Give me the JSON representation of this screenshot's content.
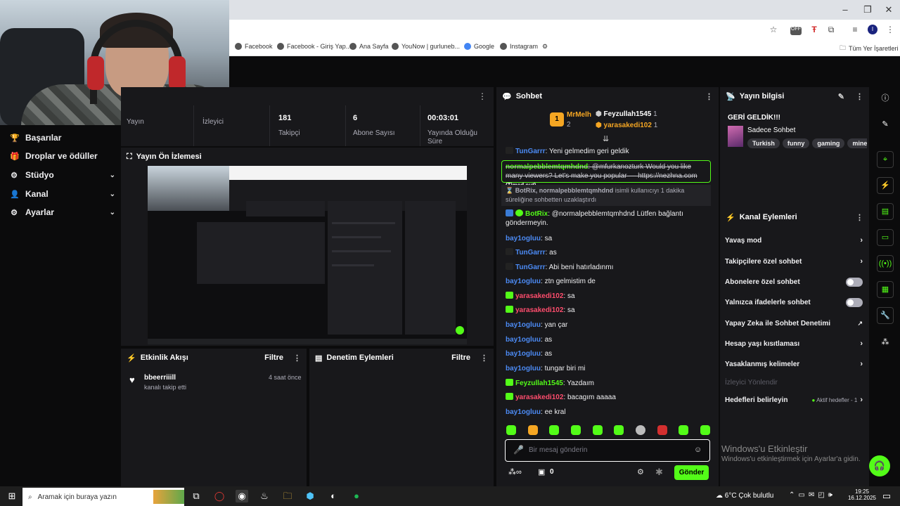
{
  "browser": {
    "bookmarks": [
      "Facebook",
      "Facebook - Giriş Yap...",
      "Ana Sayfa",
      "YouNow | gurluneb...",
      "Google",
      "Instagram"
    ],
    "all_bookmarks": "Tüm Yer İşaretleri",
    "ext_off": "OFF",
    "profile_initial": "I"
  },
  "sidebar": {
    "items": [
      {
        "label": "Başarılar",
        "icon": "trophy-icon"
      },
      {
        "label": "Droplar ve ödüller",
        "icon": "gift-icon"
      },
      {
        "label": "Stüdyo",
        "icon": "gear-icon"
      },
      {
        "label": "Kanal",
        "icon": "user-icon"
      },
      {
        "label": "Ayarlar",
        "icon": "gear-icon"
      }
    ]
  },
  "stats": {
    "items": [
      {
        "value": "",
        "label": "Yayın"
      },
      {
        "value": "",
        "label": "İzleyici"
      },
      {
        "value": "181",
        "label": "Takipçi"
      },
      {
        "value": "6",
        "label": "Abone Sayısı"
      },
      {
        "value": "00:03:01",
        "label": "Yayında Olduğu Süre"
      }
    ]
  },
  "preview": {
    "title": "Yayın Ön İzlemesi"
  },
  "activity": {
    "title": "Etkinlik Akışı",
    "filter": "Filtre",
    "events": [
      {
        "user": "bbeerriiill",
        "text": "kanalı takip etti",
        "time": "4 saat önce"
      }
    ]
  },
  "moderation": {
    "title": "Denetim Eylemleri",
    "filter": "Filtre"
  },
  "chat": {
    "title": "Sohbet",
    "top": {
      "first": {
        "name": "MrMelh",
        "count": "2",
        "rank": "1"
      },
      "second": {
        "name": "Feyzullah1545",
        "count": "1"
      },
      "third": {
        "name": "yarasakedi102",
        "count": "1"
      }
    },
    "messages": [
      {
        "user": "TunGarrr",
        "text": "Yeni gelmedim geri geldik"
      },
      {
        "user": "normalpebblemtqmhdnd",
        "text": "@mfurkanozturk Would you like many viewers? Let's make you popular — https://nezhna.com",
        "note": "(Timed out)"
      },
      {
        "user": "BotRix, normalpebblemtqmhdnd",
        "text": "isimli kullanıcıyı 1 dakika süreliğine sohbetten uzaklaştırdı"
      },
      {
        "user": "BotRix",
        "text": "@normalpebblemtqmhdnd Lütfen bağlantı göndermeyin."
      },
      {
        "user": "bay1ogluu",
        "text": "sa"
      },
      {
        "user": "TunGarrr",
        "text": "as"
      },
      {
        "user": "TunGarrr",
        "text": "Abi beni hatırladınmı"
      },
      {
        "user": "bay1ogluu",
        "text": "ztn gelmistim de"
      },
      {
        "user": "yarasakedi102",
        "text": "sa"
      },
      {
        "user": "yarasakedi102",
        "text": "sa"
      },
      {
        "user": "bay1ogluu",
        "text": "yan çar"
      },
      {
        "user": "bay1ogluu",
        "text": "as"
      },
      {
        "user": "bay1ogluu",
        "text": "as"
      },
      {
        "user": "bay1ogluu",
        "text": "tungar biri mi"
      },
      {
        "user": "Feyzullah1545",
        "text": "Yazdaım"
      },
      {
        "user": "yarasakedi102",
        "text": "bacagım aaaaa"
      },
      {
        "user": "bay1ogluu",
        "text": "ee kral"
      }
    ],
    "input_placeholder": "Bir mesaj gönderin",
    "points": "0",
    "send": "Gönder"
  },
  "info": {
    "title": "Yayın bilgisi",
    "stream_title": "GERİ GELDİK!!!",
    "category": "Sadece Sohbet",
    "tags": [
      "Turkish",
      "funny",
      "gaming",
      "minecra"
    ]
  },
  "actions": {
    "title": "Kanal Eylemleri",
    "rows": [
      {
        "label": "Yavaş mod",
        "kind": "chevron"
      },
      {
        "label": "Takipçilere özel sohbet",
        "kind": "chevron"
      },
      {
        "label": "Abonelere özel sohbet",
        "kind": "toggle"
      },
      {
        "label": "Yalnızca ifadelerle sohbet",
        "kind": "toggle"
      },
      {
        "label": "Yapay Zeka ile Sohbet Denetimi",
        "kind": "external"
      },
      {
        "label": "Hesap yaşı kısıtlaması",
        "kind": "chevron"
      },
      {
        "label": "Yasaklanmış kelimeler",
        "kind": "chevron"
      }
    ],
    "redirect": "İzleyici Yönlendir",
    "goals": {
      "label": "Hedefleri belirleyin",
      "status": "Aktif hedefler - 1"
    }
  },
  "windows": {
    "activate_title": "Windows'u Etkinleştir",
    "activate_sub": "Windows'u etkinleştirmek için Ayarlar'a gidin."
  },
  "taskbar": {
    "search": "Aramak için buraya yazın",
    "weather": "6°C  Çok bulutlu",
    "time": "19:25",
    "date": "16.12.2025"
  }
}
